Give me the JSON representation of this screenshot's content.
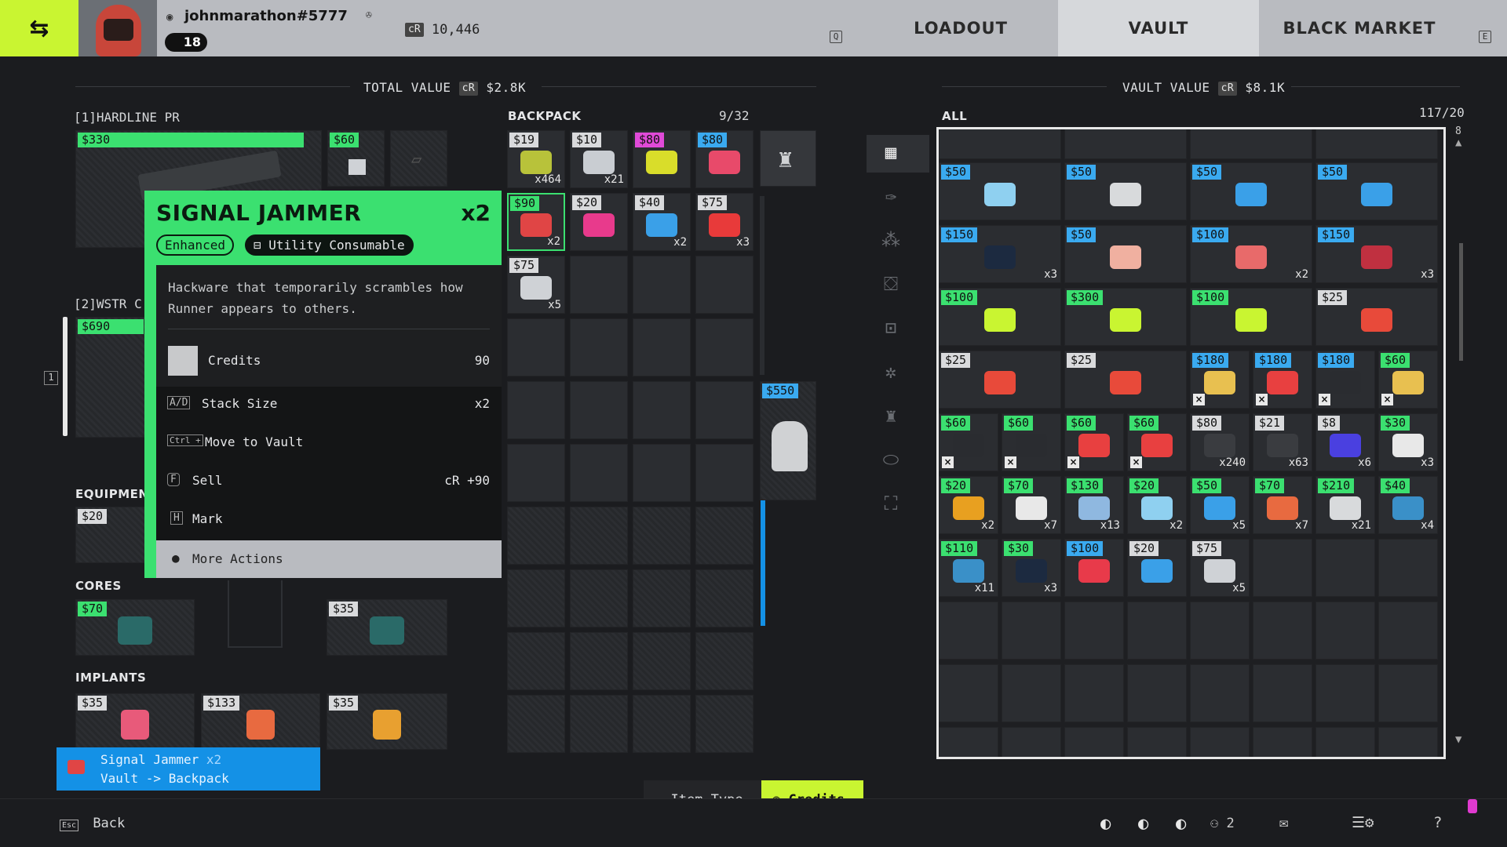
{
  "header": {
    "username": "johnmarathon#5777",
    "level": "18",
    "credits_label": "cR",
    "credits": "10,446",
    "tabs": [
      {
        "label": "LOADOUT",
        "key": "Q"
      },
      {
        "label": "VAULT"
      },
      {
        "label": "BLACK MARKET",
        "key": "E"
      }
    ]
  },
  "loadout": {
    "total_value_label": "TOTAL VALUE",
    "total_value": "$2.8K",
    "weapon1": {
      "slot": "[1]",
      "name": "HARDLINE PR",
      "price": "$330",
      "mod_price": "$60"
    },
    "weapon2": {
      "slot": "[2]",
      "name": "WSTR C",
      "price": "$690"
    },
    "slot_key": "1",
    "equipment": {
      "title": "EQUIPMENT",
      "price": "$20"
    },
    "cores": {
      "title": "CORES",
      "items": [
        {
          "price": "$70"
        },
        {
          "price": "$35"
        }
      ]
    },
    "implants": {
      "title": "IMPLANTS",
      "items": [
        {
          "price": "$35"
        },
        {
          "price": "$133"
        },
        {
          "price": "$35"
        }
      ]
    }
  },
  "backpack": {
    "title": "BACKPACK",
    "capacity": "9/32",
    "items": [
      {
        "price": "$19",
        "qty": "x464",
        "tone": "grey",
        "color": "#b8c23a"
      },
      {
        "price": "$10",
        "qty": "x21",
        "tone": "grey",
        "color": "#c9cdd2"
      },
      {
        "price": "$80",
        "qty": "",
        "tone": "mag",
        "color": "#d9dd2a"
      },
      {
        "price": "$80",
        "qty": "",
        "tone": "blue",
        "color": "#e84a6a"
      },
      {
        "price": "$90",
        "qty": "x2",
        "tone": "green",
        "color": "#e04545"
      },
      {
        "price": "$20",
        "qty": "",
        "tone": "grey",
        "color": "#e83a8c"
      },
      {
        "price": "$40",
        "qty": "x2",
        "tone": "grey",
        "color": "#3aa0e8"
      },
      {
        "price": "$75",
        "qty": "x3",
        "tone": "grey",
        "color": "#e83a3a"
      },
      {
        "price": "$75",
        "qty": "x5",
        "tone": "grey",
        "color": "#cfd2d6"
      }
    ],
    "side_price": "$550"
  },
  "tooltip": {
    "title": "SIGNAL JAMMER",
    "qty": "x2",
    "tag1": "Enhanced",
    "tag2": "Utility Consumable",
    "description": "Hackware that temporarily scrambles how Runner appears to others.",
    "credits_label": "Credits",
    "credits_value": "90",
    "actions": [
      {
        "key": "A/D",
        "label": "Stack Size",
        "value": "x2"
      },
      {
        "key": "Ctrl +",
        "label": "Move to Vault",
        "value": ""
      },
      {
        "key": "F",
        "label": "Sell",
        "value": "cR +90"
      },
      {
        "key": "H",
        "label": "Mark",
        "value": ""
      }
    ],
    "more": "More Actions"
  },
  "vault": {
    "value_label": "VAULT VALUE",
    "value": "$8.1K",
    "filter": "ALL",
    "capacity": "117/20",
    "scroll_num": "8",
    "rows": [
      [
        {
          "price": "$50",
          "tone": "blue",
          "qty": "",
          "color": "#8fd0f0"
        },
        {
          "price": "$50",
          "tone": "blue",
          "qty": "",
          "color": "#d8dadc"
        },
        {
          "price": "$50",
          "tone": "blue",
          "qty": "",
          "color": "#3aa0e8"
        },
        {
          "price": "$50",
          "tone": "blue",
          "qty": "",
          "color": "#3aa0e8"
        }
      ],
      [
        {
          "price": "$150",
          "tone": "blue",
          "qty": "x3",
          "color": "#1c2a40"
        },
        {
          "price": "$50",
          "tone": "blue",
          "qty": "",
          "color": "#f0b0a0"
        },
        {
          "price": "$100",
          "tone": "blue",
          "qty": "x2",
          "color": "#e86a6a"
        },
        {
          "price": "$150",
          "tone": "blue",
          "qty": "x3",
          "color": "#c03040"
        }
      ],
      [
        {
          "price": "$100",
          "tone": "green",
          "qty": "",
          "color": "#c9f531"
        },
        {
          "price": "$300",
          "tone": "green",
          "qty": "",
          "color": "#c9f531"
        },
        {
          "price": "$100",
          "tone": "green",
          "qty": "",
          "color": "#c9f531"
        },
        {
          "price": "$25",
          "tone": "grey",
          "qty": "",
          "color": "#e84a3a"
        }
      ],
      [
        {
          "price": "$25",
          "tone": "grey",
          "qty": "",
          "color": "#e84a3a"
        },
        {
          "price": "$25",
          "tone": "grey",
          "qty": "",
          "color": "#e84a3a"
        }
      ]
    ],
    "row5": [
      {
        "price": "$180",
        "tone": "blue",
        "qty": "",
        "color": "#e8c050",
        "x": true
      },
      {
        "price": "$180",
        "tone": "blue",
        "qty": "",
        "color": "#e84040",
        "x": true
      },
      {
        "price": "$180",
        "tone": "blue",
        "qty": "",
        "color": "#2a2c30",
        "x": true
      },
      {
        "price": "$60",
        "tone": "green",
        "qty": "",
        "color": "#e8c050",
        "x": true
      }
    ],
    "row6": [
      {
        "price": "$60",
        "tone": "green",
        "qty": "",
        "color": "#2a2c30",
        "x": true
      },
      {
        "price": "$60",
        "tone": "green",
        "qty": "",
        "color": "#2a2c30",
        "x": true
      },
      {
        "price": "$60",
        "tone": "green",
        "qty": "",
        "color": "#e84040",
        "x": true
      },
      {
        "price": "$60",
        "tone": "green",
        "qty": "",
        "color": "#e84040",
        "x": true
      },
      {
        "price": "$80",
        "tone": "grey",
        "qty": "x240",
        "color": "#3a3c40"
      },
      {
        "price": "$21",
        "tone": "grey",
        "qty": "x63",
        "color": "#3a3c40"
      },
      {
        "price": "$8",
        "tone": "grey",
        "qty": "x6",
        "color": "#4a40e0"
      },
      {
        "price": "$30",
        "tone": "green",
        "qty": "x3",
        "color": "#e8e8e8"
      }
    ],
    "row7": [
      {
        "price": "$20",
        "tone": "green",
        "qty": "x2",
        "color": "#e8a020"
      },
      {
        "price": "$70",
        "tone": "green",
        "qty": "x7",
        "color": "#e8e8e8"
      },
      {
        "price": "$130",
        "tone": "green",
        "qty": "x13",
        "color": "#8fb8e0"
      },
      {
        "price": "$20",
        "tone": "green",
        "qty": "x2",
        "color": "#8fd0f0"
      },
      {
        "price": "$50",
        "tone": "green",
        "qty": "x5",
        "color": "#3aa0e8"
      },
      {
        "price": "$70",
        "tone": "green",
        "qty": "x7",
        "color": "#e86a40"
      },
      {
        "price": "$210",
        "tone": "green",
        "qty": "x21",
        "color": "#d8dadc"
      },
      {
        "price": "$40",
        "tone": "green",
        "qty": "x4",
        "color": "#3a90c8"
      }
    ],
    "row8": [
      {
        "price": "$110",
        "tone": "green",
        "qty": "x11",
        "color": "#3a90c8"
      },
      {
        "price": "$30",
        "tone": "green",
        "qty": "x3",
        "color": "#1c2a40"
      },
      {
        "price": "$100",
        "tone": "blue",
        "qty": "",
        "color": "#e83a4a"
      },
      {
        "price": "$20",
        "tone": "grey",
        "qty": "",
        "color": "#3aa0e8"
      },
      {
        "price": "$75",
        "tone": "grey",
        "qty": "x5",
        "color": "#cfd2d6"
      }
    ]
  },
  "toast": {
    "name": "Signal Jammer",
    "qty": "x2",
    "route": "Vault -> Backpack"
  },
  "footer": {
    "back_key": "Esc",
    "back": "Back",
    "sort_item_type": "Item Type",
    "sort_credits": "Credits",
    "party_count": "2",
    "help": "?"
  },
  "colors": {
    "accent_green": "#3be070",
    "lime": "#c9f531",
    "blue": "#1491e6"
  }
}
